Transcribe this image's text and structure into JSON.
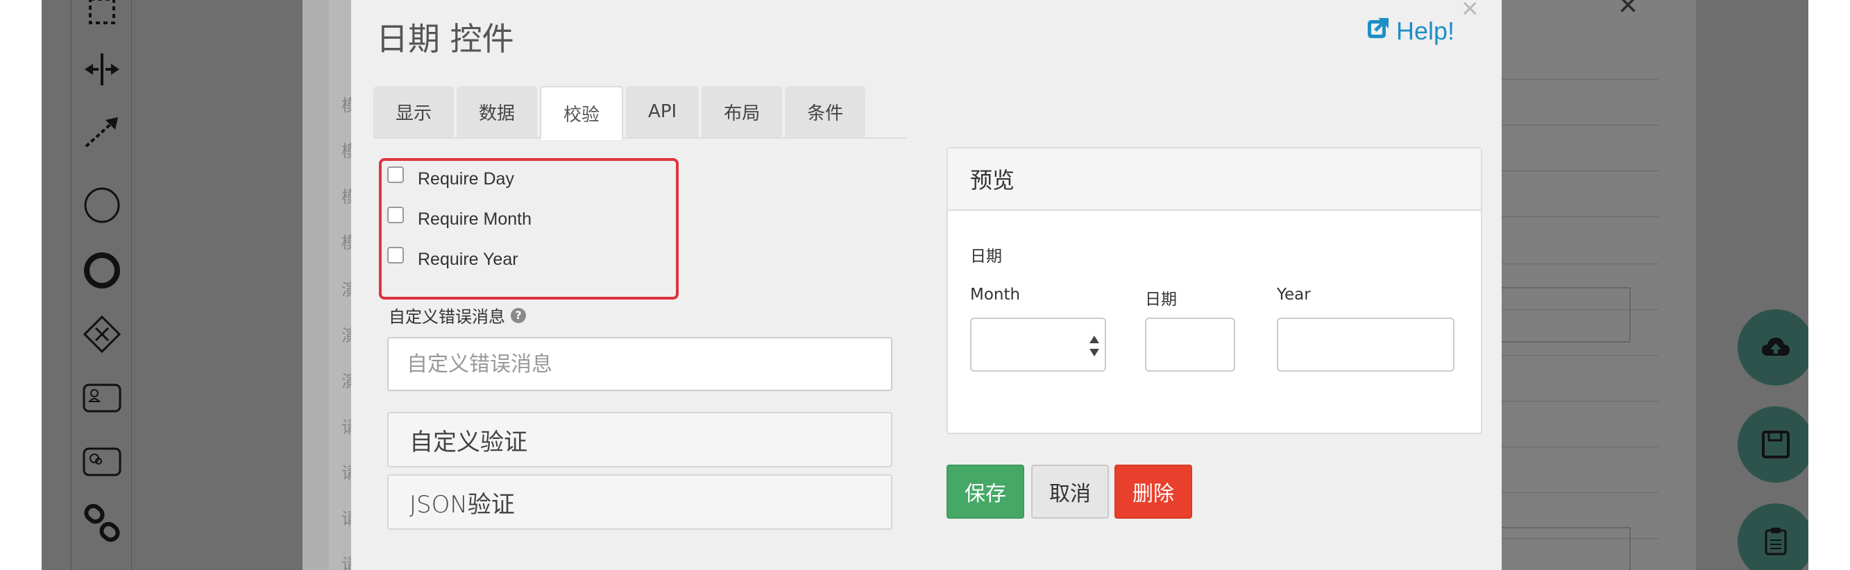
{
  "background_app": {
    "row_chars": [
      "模",
      "模",
      "模",
      "模",
      "演",
      "演",
      "演",
      "请",
      "请",
      "请",
      "请"
    ],
    "tool_icons": [
      "select-box-icon",
      "split-icon",
      "connection-arrow-icon",
      "start-event-icon",
      "end-event-icon",
      "gateway-icon",
      "user-task-icon",
      "service-task-icon",
      "link-icon"
    ],
    "fab_icons": [
      "cloud-upload-icon",
      "save-icon",
      "clipboard-icon"
    ],
    "close_glyph": "×"
  },
  "dialog": {
    "title": "日期 控件",
    "help_label": "Help!",
    "close_glyph": "×",
    "tabs": [
      {
        "label": "显示",
        "active": false
      },
      {
        "label": "数据",
        "active": false
      },
      {
        "label": "校验",
        "active": true
      },
      {
        "label": "API",
        "active": false
      },
      {
        "label": "布局",
        "active": false
      },
      {
        "label": "条件",
        "active": false
      }
    ],
    "validation": {
      "options": [
        {
          "label": "Require Day",
          "checked": false
        },
        {
          "label": "Require Month",
          "checked": false
        },
        {
          "label": "Require Year",
          "checked": false
        }
      ],
      "highlight_color": "#e0333f"
    },
    "custom_error": {
      "label": "自定义错误消息",
      "help_glyph": "?",
      "placeholder": "自定义错误消息",
      "value": ""
    },
    "panels": [
      {
        "label": "自定义验证"
      },
      {
        "label": "JSON验证"
      }
    ],
    "preview": {
      "heading": "预览",
      "field_label": "日期",
      "month_label": "Month",
      "day_label": "日期",
      "year_label": "Year",
      "month_value": "",
      "day_value": "",
      "year_value": ""
    },
    "buttons": {
      "save": "保存",
      "cancel": "取消",
      "delete": "删除"
    },
    "colors": {
      "help_link": "#1e8fc6",
      "save": "#45a866",
      "delete": "#e8402c",
      "fab": "#5ca79a"
    }
  }
}
